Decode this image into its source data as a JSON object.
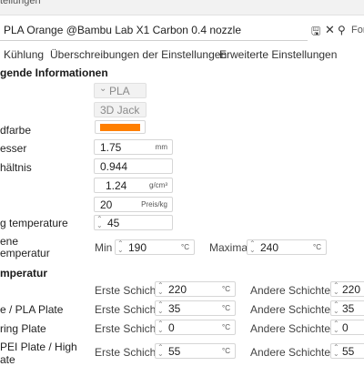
{
  "window": {
    "title_fragment": "tellungen"
  },
  "preset": {
    "name": "PLA Orange @Bambu Lab X1 Carbon 0.4 nozzle",
    "search_label": "Fort"
  },
  "tabs": [
    "Kühlung",
    "Überschreibungen der Einstellungen",
    "Erweiterte Einstellungen"
  ],
  "sections": {
    "basic": "gende Informationen",
    "temperature": "mperatur"
  },
  "basic": {
    "type_value": "PLA",
    "vendor_value": "3D Jack",
    "colour_label": "dfarbe",
    "colour": "#ff7f00",
    "diameter_label": "esser",
    "diameter_value": "1.75",
    "diameter_unit": "mm",
    "flow_label": "hältnis",
    "flow_value": "0.944",
    "density_value": "1.24",
    "density_unit": "g/cm³",
    "cost_value": "20",
    "cost_unit": "Preis/kg",
    "soft_label": "g temperature",
    "soft_value": "45",
    "range_label_1": "ene",
    "range_label_2": "emperatur",
    "min_label": "Min",
    "min_value": "190",
    "max_label": "Maximal",
    "max_value": "240",
    "temp_unit": "°C"
  },
  "plates": [
    {
      "label": "",
      "first_label": "Erste Schicht",
      "first_value": "220",
      "other_label": "Andere Schichten",
      "other_value": "220"
    },
    {
      "label": "e / PLA Plate",
      "first_label": "Erste Schicht",
      "first_value": "35",
      "other_label": "Andere Schichten",
      "other_value": "35"
    },
    {
      "label": "ring Plate",
      "first_label": "Erste Schicht",
      "first_value": "0",
      "other_label": "Andere Schichten",
      "other_value": "0"
    },
    {
      "label_1": "PEI Plate / High",
      "label_2": "ate",
      "first_label": "Erste Schicht",
      "first_value": "55",
      "other_label": "Andere Schichten",
      "other_value": "55"
    }
  ]
}
